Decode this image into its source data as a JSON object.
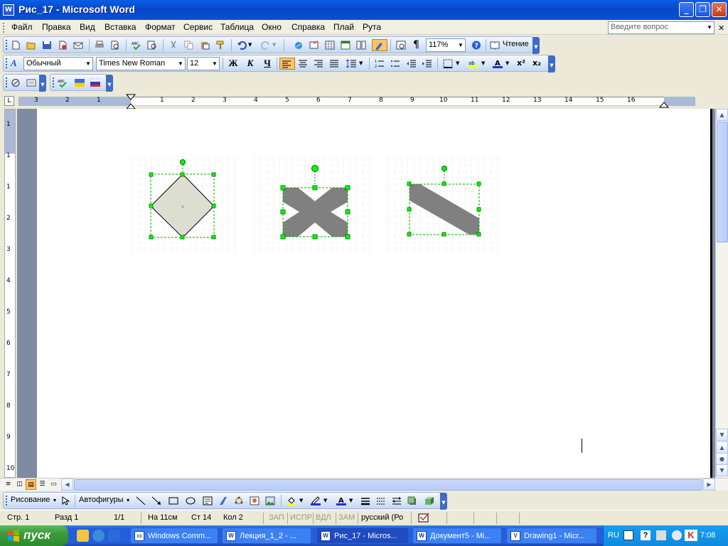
{
  "window": {
    "title": "Рис_17 - Microsoft Word",
    "app_icon": "W",
    "min": "_",
    "max": "❐",
    "close": "✕"
  },
  "menu": {
    "items": [
      "Файл",
      "Правка",
      "Вид",
      "Вставка",
      "Формат",
      "Сервис",
      "Таблица",
      "Окно",
      "Справка",
      "Плай",
      "Рута"
    ],
    "ask_placeholder": "Введите вопрос",
    "close_doc": "✕"
  },
  "standard_toolbar": {
    "zoom": "117%",
    "reading": "Чтение"
  },
  "format_toolbar": {
    "style": "Обычный",
    "font": "Times New Roman",
    "size": "12",
    "bold": "Ж",
    "italic": "К",
    "underline": "Ч"
  },
  "ruler": {
    "tab_selector": "L",
    "numbers": [
      "3",
      "2",
      "1",
      "1",
      "2",
      "3",
      "4",
      "5",
      "6",
      "7",
      "8",
      "9",
      "10",
      "11",
      "12",
      "13",
      "14",
      "15",
      "16"
    ],
    "vnumbers": [
      "1",
      "1",
      "1",
      "2",
      "3",
      "4",
      "5",
      "6",
      "7",
      "8",
      "9",
      "10"
    ]
  },
  "drawing_toolbar": {
    "draw": "Рисование",
    "autoshapes": "Автофигуры"
  },
  "status": {
    "page": "Стр. 1",
    "section": "Разд 1",
    "pages": "1/1",
    "at": "На 11см",
    "line": "Ст 14",
    "col": "Кол 2",
    "rec": "ЗАП",
    "trk": "ИСПР",
    "ext": "ВДЛ",
    "ovr": "ЗАМ",
    "lang": "русский (Ро"
  },
  "taskbar": {
    "start": "пуск",
    "buttons": [
      "Windows Comm...",
      "Лекция_1_2 - ...",
      "Рис_17 - Micros...",
      "Документ5 - Mi...",
      "Drawing1 - Micr..."
    ],
    "lang": "RU",
    "clock": "7:08"
  },
  "colors": {
    "diamond_fill": "#dcdfd0",
    "shape_gray": "#808080",
    "handle_green": "#00ff00",
    "title_blue": "#0a5fe6"
  }
}
